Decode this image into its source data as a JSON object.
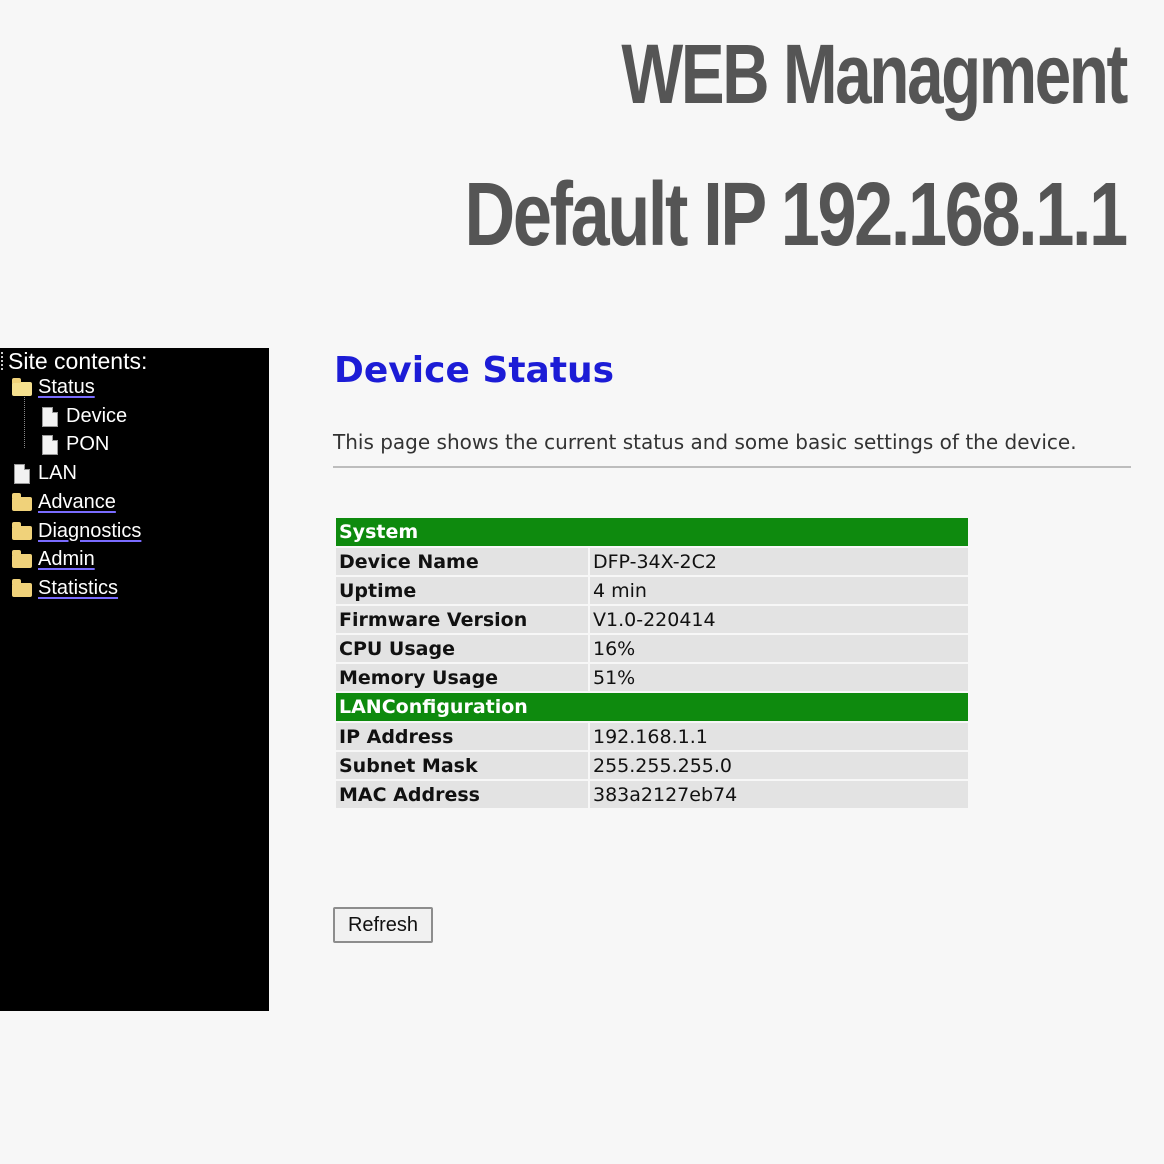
{
  "banner": {
    "line1": "WEB Managment",
    "line2": "Default IP 192.168.1.1"
  },
  "sidebar": {
    "title": "Site contents:",
    "items": [
      {
        "label": "Status",
        "icon": "folder-open-icon"
      },
      {
        "label": "Device",
        "icon": "page-icon"
      },
      {
        "label": "PON",
        "icon": "page-icon"
      },
      {
        "label": "LAN",
        "icon": "page-icon"
      },
      {
        "label": "Advance",
        "icon": "folder-icon"
      },
      {
        "label": "Diagnostics",
        "icon": "folder-icon"
      },
      {
        "label": "Admin",
        "icon": "folder-icon"
      },
      {
        "label": "Statistics",
        "icon": "folder-icon"
      }
    ]
  },
  "main": {
    "title": "Device Status",
    "description": "This page shows the current status and some basic settings of the device.",
    "sections": [
      {
        "heading": "System",
        "rows": [
          {
            "key": "Device Name",
            "value": "DFP-34X-2C2"
          },
          {
            "key": "Uptime",
            "value": "4 min"
          },
          {
            "key": "Firmware Version",
            "value": "V1.0-220414"
          },
          {
            "key": "CPU Usage",
            "value": "16%"
          },
          {
            "key": "Memory Usage",
            "value": "51%"
          }
        ]
      },
      {
        "heading": "LANConfiguration",
        "rows": [
          {
            "key": "IP Address",
            "value": "192.168.1.1"
          },
          {
            "key": "Subnet Mask",
            "value": "255.255.255.0"
          },
          {
            "key": "MAC Address",
            "value": "383a2127eb74"
          }
        ]
      }
    ],
    "refresh_label": "Refresh"
  },
  "colors": {
    "title_blue": "#1c1cd6",
    "section_green": "#0e8a0e",
    "banner_gray": "#555555",
    "sidebar_bg": "#000000"
  }
}
